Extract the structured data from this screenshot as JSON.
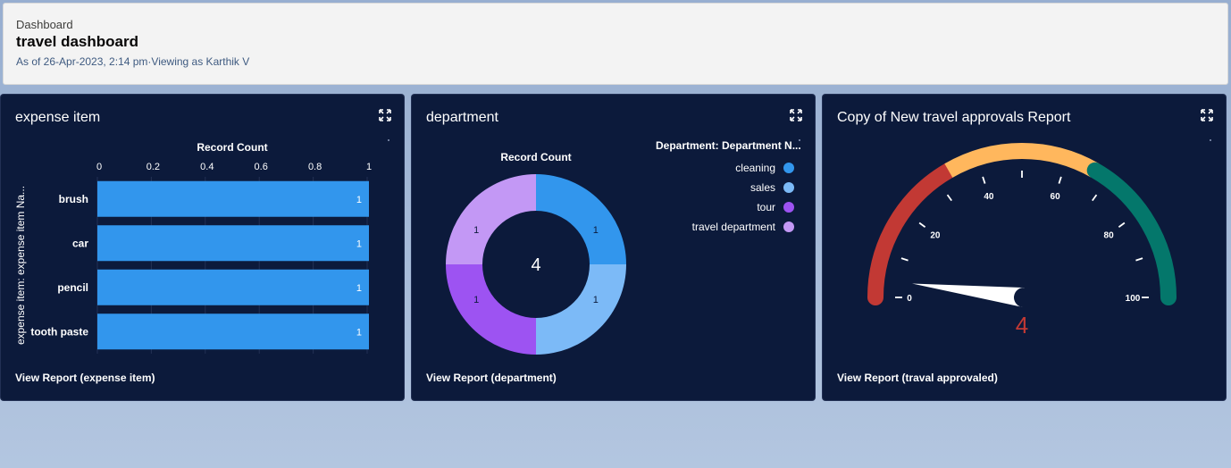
{
  "header": {
    "kicker": "Dashboard",
    "title": "travel dashboard",
    "subtitle": "As of 26-Apr-2023, 2:14 pm·Viewing as Karthik V"
  },
  "cards": [
    {
      "title": "expense item",
      "footer": "View Report (expense item)",
      "icon": "expand-icon"
    },
    {
      "title": "department",
      "footer": "View Report (department)",
      "icon": "expand-icon"
    },
    {
      "title": "Copy of New travel approvals Report",
      "footer": "View Report (traval approvaled)",
      "icon": "expand-icon"
    }
  ],
  "colors": {
    "card_bg": "#0c1a3b",
    "bar": "#3296ed",
    "donut": [
      "#3296ed",
      "#7cbaf7",
      "#9d53f2",
      "#c398f5"
    ],
    "gauge": [
      "#c23934",
      "#ffb75d",
      "#04776b"
    ],
    "gauge_value": "#c23934"
  },
  "chart_data": [
    {
      "type": "bar",
      "orientation": "horizontal",
      "title": "Record Count",
      "xlabel": "Record Count",
      "ylabel": "expense item: expense item Na...",
      "categories": [
        "brush",
        "car",
        "pencil",
        "tooth paste"
      ],
      "values": [
        1,
        1,
        1,
        1
      ],
      "data_labels": [
        "1",
        "1",
        "1",
        "1"
      ],
      "xlim": [
        0,
        1
      ],
      "x_ticks": [
        "0",
        "0.2",
        "0.4",
        "0.6",
        "0.8",
        "1"
      ],
      "grid": true
    },
    {
      "type": "pie",
      "variant": "donut",
      "title": "Record Count",
      "center_value": "4",
      "legend_title": "Department: Department N...",
      "legend_position": "right",
      "categories": [
        "cleaning",
        "sales",
        "tour",
        "travel department"
      ],
      "values": [
        1,
        1,
        1,
        1
      ],
      "data_labels": [
        "1",
        "1",
        "1",
        "1"
      ]
    },
    {
      "type": "gauge",
      "value": 4,
      "value_label": "4",
      "range": [
        0,
        100
      ],
      "tick_labels": [
        "0",
        "20",
        "40",
        "60",
        "80",
        "100"
      ],
      "bands": [
        [
          0,
          33.3
        ],
        [
          33.3,
          66.6
        ],
        [
          66.6,
          100
        ]
      ]
    }
  ]
}
